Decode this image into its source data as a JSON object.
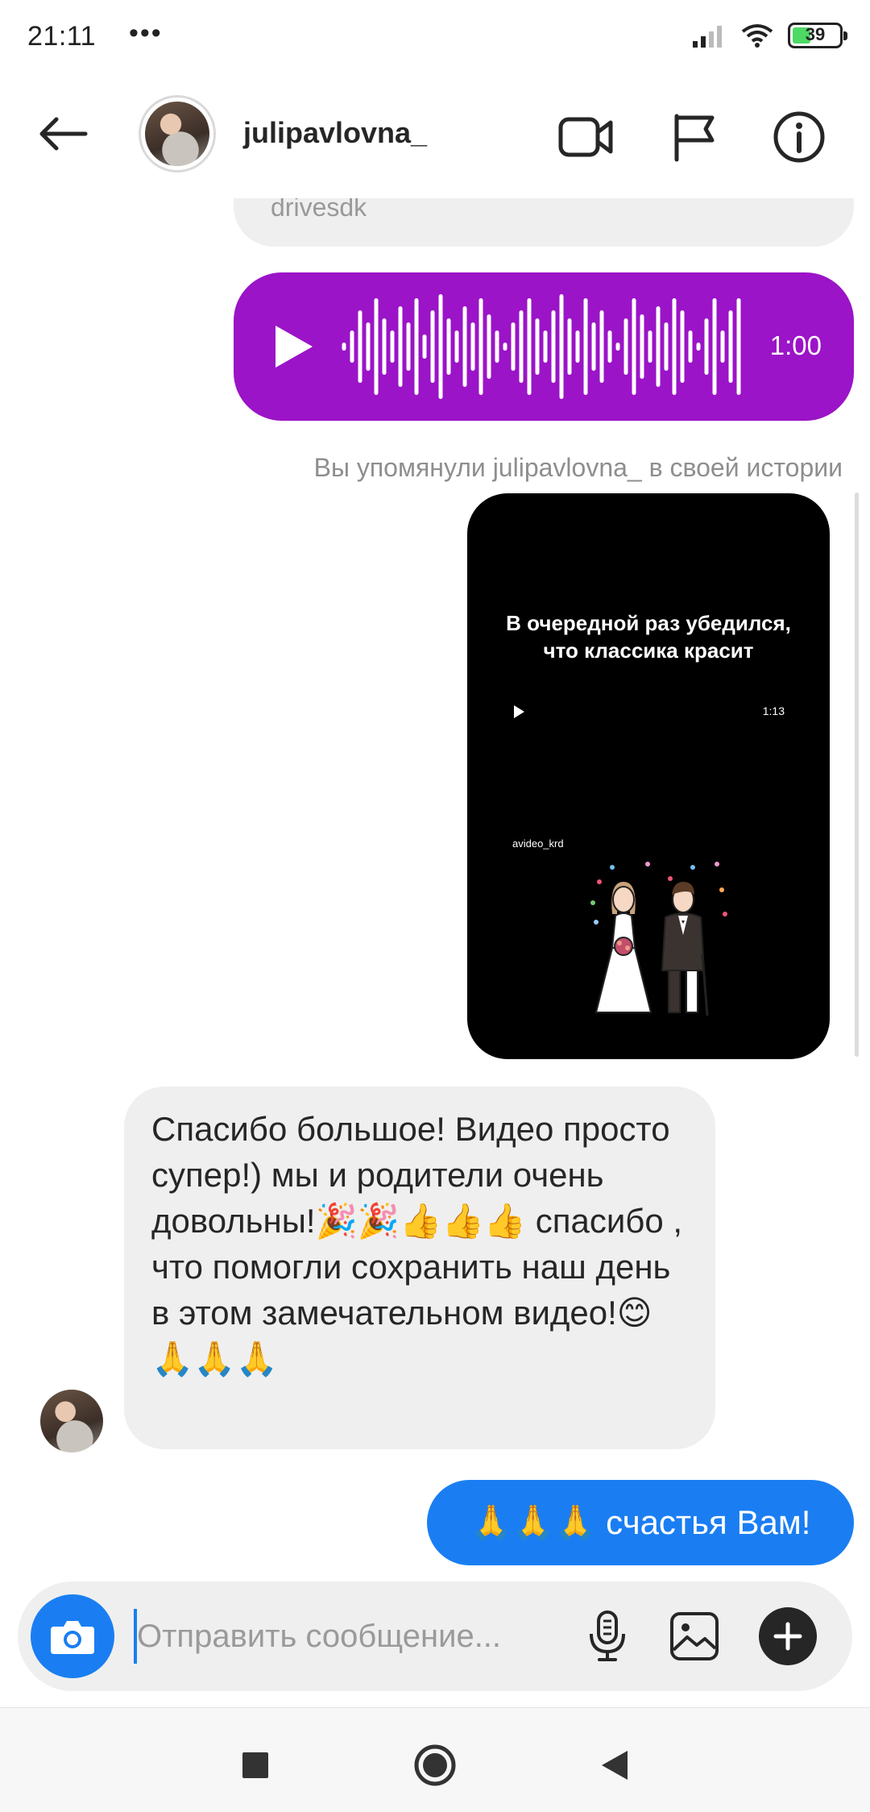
{
  "status_bar": {
    "time": "21:11",
    "dots": "•••",
    "battery": "39",
    "icons": [
      "signal-icon",
      "wifi-icon",
      "battery-icon"
    ]
  },
  "header": {
    "username": "julipavlovna_",
    "icons": [
      "back-arrow-icon",
      "video-call-icon",
      "flag-icon",
      "info-icon"
    ]
  },
  "messages": {
    "partial_sender_text": "drivesdk",
    "voice": {
      "duration": "1:00",
      "color": "#9b14c7"
    },
    "mention_note": "Вы упомянули julipavlovna_ в своей истории",
    "story": {
      "line1": "В очередной раз убедился,",
      "line2": "что классика красит",
      "duration": "1:13",
      "author": "avideo_krd"
    },
    "incoming_text": "Спасибо большое! Видео просто супер!) мы и родители очень довольны!🎉🎉👍👍👍  спасибо , что помогли сохранить наш день в этом замечательном видео!😊🙏🙏🙏",
    "outgoing_text": "🙏🙏🙏 счастья Вам!",
    "outgoing_color": "#1a7ef2"
  },
  "composer": {
    "placeholder": "Отправить сообщение...",
    "icons": [
      "camera-icon",
      "microphone-icon",
      "gallery-icon",
      "plus-icon"
    ]
  },
  "navbar": {
    "icons": [
      "recents-square-icon",
      "home-circle-icon",
      "back-triangle-icon"
    ]
  }
}
